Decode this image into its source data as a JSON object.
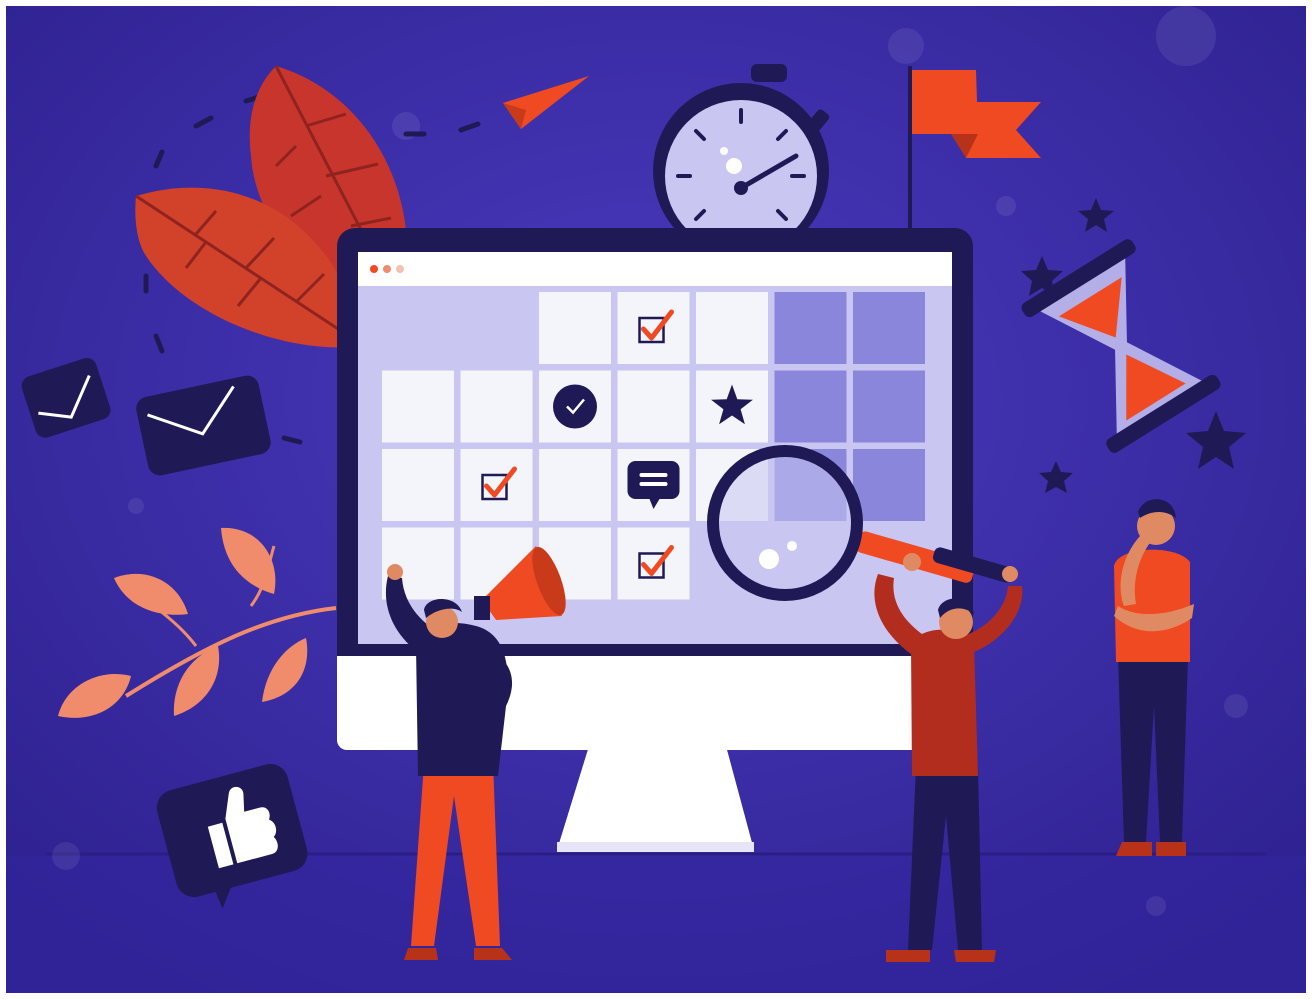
{
  "scene": {
    "subject": "calendar-planning-illustration",
    "palette": {
      "background": "#3a2ba6",
      "background_dark": "#2c1f8c",
      "navy": "#1f1a55",
      "orange": "#f04a23",
      "red": "#d2412a",
      "leaf_red": "#c8352c",
      "peach": "#f08c6c",
      "lavender": "#c9c6f2",
      "cell_white": "#f4f4fb",
      "cell_purple": "#8a86dc",
      "white": "#ffffff"
    },
    "calendar_cells": [
      {
        "row": 0,
        "col": 2,
        "state": "empty"
      },
      {
        "row": 0,
        "col": 3,
        "state": "checked"
      },
      {
        "row": 0,
        "col": 4,
        "state": "empty"
      },
      {
        "row": 0,
        "col": 5,
        "state": "filled"
      },
      {
        "row": 0,
        "col": 6,
        "state": "filled"
      },
      {
        "row": 1,
        "col": 0,
        "state": "empty"
      },
      {
        "row": 1,
        "col": 1,
        "state": "empty"
      },
      {
        "row": 1,
        "col": 2,
        "state": "clock"
      },
      {
        "row": 1,
        "col": 3,
        "state": "empty"
      },
      {
        "row": 1,
        "col": 4,
        "state": "star"
      },
      {
        "row": 1,
        "col": 5,
        "state": "filled"
      },
      {
        "row": 1,
        "col": 6,
        "state": "filled"
      },
      {
        "row": 2,
        "col": 0,
        "state": "empty"
      },
      {
        "row": 2,
        "col": 1,
        "state": "checked"
      },
      {
        "row": 2,
        "col": 2,
        "state": "empty"
      },
      {
        "row": 2,
        "col": 3,
        "state": "message"
      },
      {
        "row": 2,
        "col": 4,
        "state": "empty"
      },
      {
        "row": 2,
        "col": 5,
        "state": "filled"
      },
      {
        "row": 2,
        "col": 6,
        "state": "filled"
      },
      {
        "row": 3,
        "col": 0,
        "state": "empty"
      },
      {
        "row": 3,
        "col": 1,
        "state": "empty"
      },
      {
        "row": 3,
        "col": 2,
        "state": "empty"
      },
      {
        "row": 3,
        "col": 3,
        "state": "checked"
      }
    ],
    "icons": [
      "paper-plane-icon",
      "stopwatch-icon",
      "flag-icon",
      "hourglass-icon",
      "envelope-icon",
      "thumbs-up-icon",
      "magnifier-icon",
      "megaphone-icon",
      "star-icon",
      "leaf-icon"
    ]
  }
}
